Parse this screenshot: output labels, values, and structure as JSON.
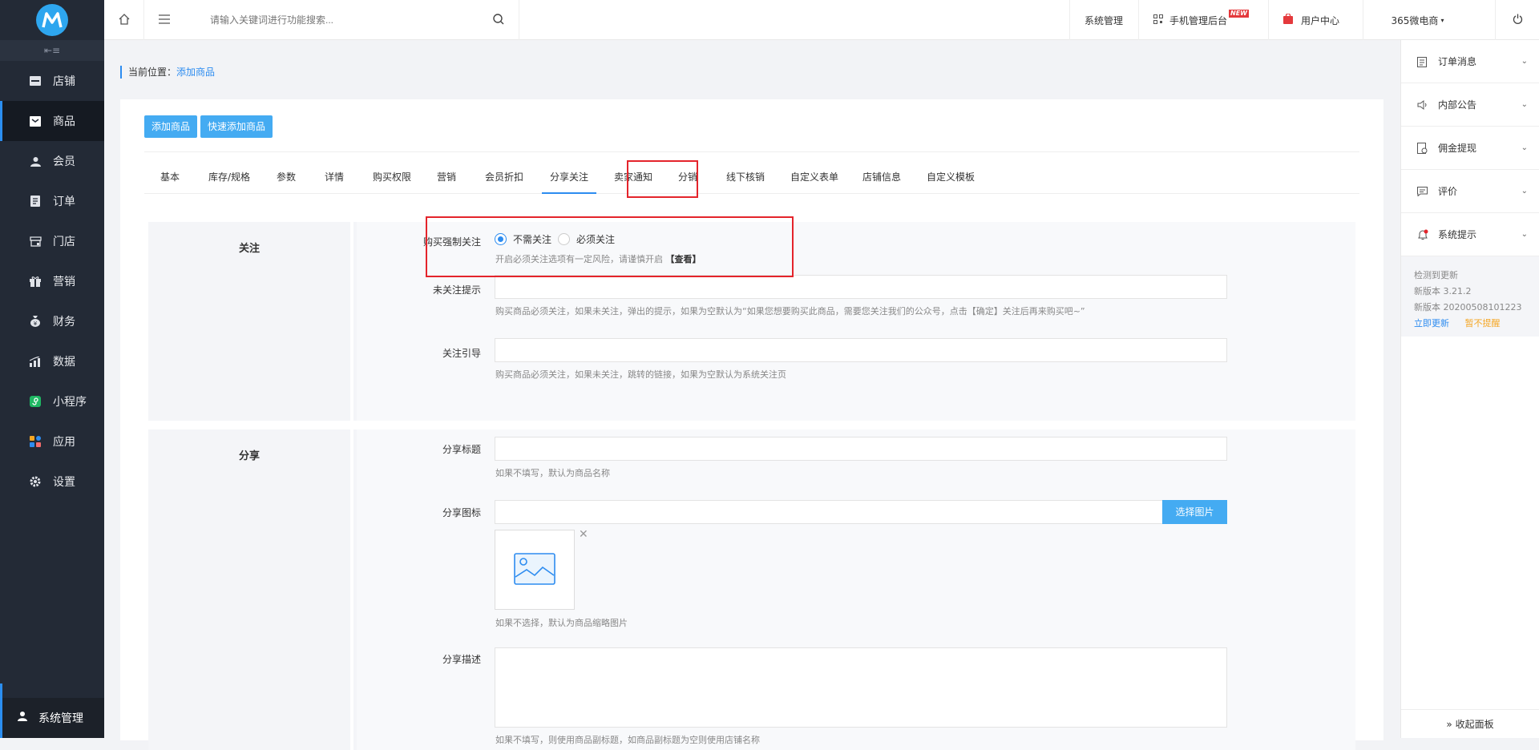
{
  "sidebar": {
    "collapse_icon": "collapse-icon",
    "items": [
      {
        "label": "店铺",
        "icon": "shop-icon"
      },
      {
        "label": "商品",
        "icon": "goods-icon"
      },
      {
        "label": "会员",
        "icon": "member-icon"
      },
      {
        "label": "订单",
        "icon": "order-icon"
      },
      {
        "label": "门店",
        "icon": "store-icon"
      },
      {
        "label": "营销",
        "icon": "marketing-icon"
      },
      {
        "label": "财务",
        "icon": "finance-icon"
      },
      {
        "label": "数据",
        "icon": "data-icon"
      },
      {
        "label": "小程序",
        "icon": "miniprogram-icon"
      },
      {
        "label": "应用",
        "icon": "apps-icon"
      },
      {
        "label": "设置",
        "icon": "settings-icon"
      }
    ],
    "bottom": "系统管理",
    "active_color": "#2b8ef0"
  },
  "topbar": {
    "search_placeholder": "请输入关键词进行功能搜索...",
    "system": "系统管理",
    "mobile": "手机管理后台",
    "new_badge": "NEW",
    "user_center": "用户中心",
    "account": "365微电商"
  },
  "breadcrumb": {
    "prefix": "当前位置：",
    "current": "添加商品"
  },
  "buttons": {
    "add": "添加商品",
    "quick_add": "快速添加商品"
  },
  "tabs": [
    "基本",
    "库存/规格",
    "参数",
    "详情",
    "购买权限",
    "营销",
    "会员折扣",
    "分享关注",
    "卖家通知",
    "分销",
    "线下核销",
    "自定义表单",
    "店铺信息",
    "自定义模板"
  ],
  "active_tab": "分享关注",
  "follow": {
    "title": "关注",
    "force_label": "购买强制关注",
    "opt_no": "不需关注",
    "opt_yes": "必须关注",
    "force_hint": "开启必须关注选项有一定风险，请谨慎开启",
    "force_view": "【查看】",
    "unfollow_label": "未关注提示",
    "unfollow_hint": "购买商品必须关注，如果未关注，弹出的提示，如果为空默认为“如果您想要购买此商品，需要您关注我们的公众号，点击【确定】关注后再来购买吧~”",
    "guide_label": "关注引导",
    "guide_hint": "购买商品必须关注，如果未关注，跳转的链接，如果为空默认为系统关注页"
  },
  "share": {
    "title": "分享",
    "title_label": "分享标题",
    "title_hint": "如果不填写，默认为商品名称",
    "icon_label": "分享图标",
    "select_btn": "选择图片",
    "icon_hint": "如果不选择，默认为商品缩略图片",
    "desc_label": "分享描述",
    "desc_hint": "如果不填写，则使用商品副标题，如商品副标题为空则使用店铺名称"
  },
  "right_panel": {
    "items": [
      {
        "label": "订单消息",
        "icon": "order-msg-icon"
      },
      {
        "label": "内部公告",
        "icon": "announcement-icon"
      },
      {
        "label": "佣金提现",
        "icon": "commission-icon"
      },
      {
        "label": "评价",
        "icon": "review-icon"
      },
      {
        "label": "系统提示",
        "icon": "bell-icon"
      }
    ],
    "update_title": "检测到更新",
    "version": "新版本 3.21.2",
    "build": "新版本 20200508101223",
    "update_now": "立即更新",
    "remind_later": "暂不提醒",
    "collapse": "» 收起面板"
  }
}
